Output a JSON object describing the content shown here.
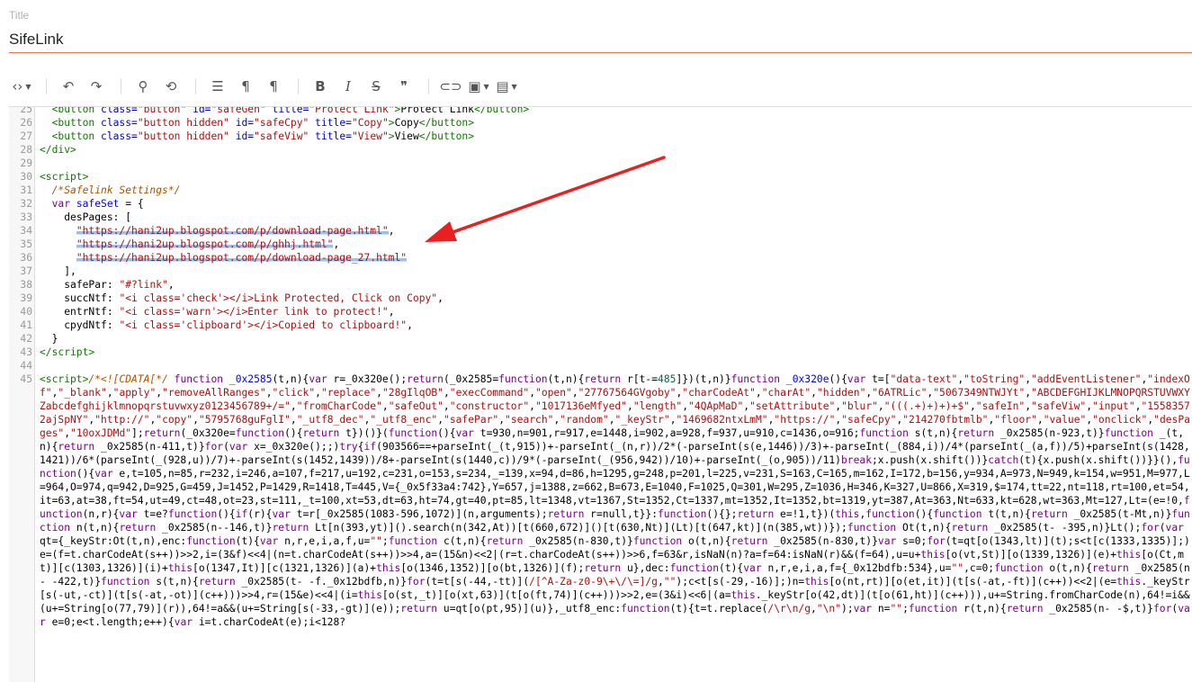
{
  "title_field": {
    "label": "Title",
    "value": "SifeLink"
  },
  "toolbar": {
    "items": [
      {
        "icon": "code-view-icon",
        "glyph": "‹›",
        "caret": true
      },
      {
        "sep": true
      },
      {
        "icon": "undo-icon",
        "glyph": "↶"
      },
      {
        "icon": "redo-icon",
        "glyph": "↷"
      },
      {
        "sep": true
      },
      {
        "icon": "search-icon",
        "glyph": "⚲"
      },
      {
        "icon": "find-replace-icon",
        "glyph": "⟲"
      },
      {
        "sep": true
      },
      {
        "icon": "align-icon",
        "glyph": "☰"
      },
      {
        "icon": "ltr-icon",
        "glyph": "¶"
      },
      {
        "icon": "rtl-icon",
        "glyph": "¶"
      },
      {
        "sep": true
      },
      {
        "icon": "bold-icon",
        "glyph": "B"
      },
      {
        "icon": "italic-icon",
        "glyph": "I"
      },
      {
        "icon": "strikethrough-icon",
        "glyph": "S"
      },
      {
        "icon": "quote-icon",
        "glyph": "❞"
      },
      {
        "sep": true
      },
      {
        "icon": "link-icon",
        "glyph": "⊂⊃"
      },
      {
        "icon": "image-icon",
        "glyph": "▣",
        "caret": true
      },
      {
        "icon": "video-icon",
        "glyph": "▤",
        "caret": true
      }
    ]
  },
  "code_lines": [
    {
      "n": "25",
      "html": "  <span class='tag'>&lt;button</span> <span class='attr'>class=</span><span class='str'>\"button\"</span> <span class='attr'>id=</span><span class='str'>\"safeGen\"</span> <span class='attr'>title=</span><span class='str'>\"Protect Link\"</span><span class='tag'>&gt;</span>Protect Link<span class='tag'>&lt;/button&gt;</span>"
    },
    {
      "n": "26",
      "html": "  <span class='tag'>&lt;button</span> <span class='attr'>class=</span><span class='str'>\"button hidden\"</span> <span class='attr'>id=</span><span class='str'>\"safeCpy\"</span> <span class='attr'>title=</span><span class='str'>\"Copy\"</span><span class='tag'>&gt;</span>Copy<span class='tag'>&lt;/button&gt;</span>"
    },
    {
      "n": "27",
      "html": "  <span class='tag'>&lt;button</span> <span class='attr'>class=</span><span class='str'>\"button hidden\"</span> <span class='attr'>id=</span><span class='str'>\"safeViw\"</span> <span class='attr'>title=</span><span class='str'>\"View\"</span><span class='tag'>&gt;</span>View<span class='tag'>&lt;/button&gt;</span>"
    },
    {
      "n": "28",
      "html": "<span class='tag'>&lt;/div&gt;</span>"
    },
    {
      "n": "29",
      "html": ""
    },
    {
      "n": "30",
      "html": "<span class='tag'>&lt;script&gt;</span>"
    },
    {
      "n": "31",
      "html": "  <span class='cm'>/*Safelink Settings*/</span>"
    },
    {
      "n": "32",
      "html": "  <span class='kw'>var</span> <span class='def'>safeSet</span> = {"
    },
    {
      "n": "33",
      "html": "    desPages: ["
    },
    {
      "n": "34",
      "html": "      <span class='str hl'>\"https://hani2up.blogspot.com/p/download-page.html\"</span>,"
    },
    {
      "n": "35",
      "html": "      <span class='str hl'>\"https://hani2up.blogspot.com/p/ghhj.html\"</span>,"
    },
    {
      "n": "36",
      "html": "      <span class='str hl'>\"https://hani2up.blogspot.com/p/download-page_27.html\"</span>"
    },
    {
      "n": "37",
      "html": "    ],"
    },
    {
      "n": "38",
      "html": "    safePar: <span class='str'>\"#?link\"</span>,"
    },
    {
      "n": "39",
      "html": "    succNtf: <span class='str'>\"&lt;i class='check'&gt;&lt;/i&gt;Link Protected, Click on Copy\"</span>,"
    },
    {
      "n": "40",
      "html": "    entrNtf: <span class='str'>\"&lt;i class='warn'&gt;&lt;/i&gt;Enter link to protect!\"</span>,"
    },
    {
      "n": "41",
      "html": "    cpydNtf: <span class='str'>\"&lt;i class='clipboard'&gt;&lt;/i&gt;Copied to clipboard!\"</span>,"
    },
    {
      "n": "42",
      "html": "  }"
    },
    {
      "n": "43",
      "html": "<span class='tag'>&lt;/script&gt;</span>"
    },
    {
      "n": "44",
      "html": ""
    },
    {
      "n": "45",
      "html": "<span class='tag'>&lt;script&gt;</span><span class='cm'>/*&lt;![CDATA[*/</span> <span class='kw'>function</span> <span class='def'>_0x2585</span>(t,n){<span class='kw'>var</span> r=_0x320e();<span class='kw'>return</span>(_0x2585=<span class='kw'>function</span>(t,n){<span class='kw'>return</span> r[t-=<span class='num'>485</span>]})(t,n)}<span class='kw'>function</span> <span class='def'>_0x320e</span>(){<span class='kw'>var</span> t=[<span class='str'>\"data-text\"</span>,<span class='str'>\"toString\"</span>,<span class='str'>\"addEventListener\"</span>,<span class='str'>\"indexOf\"</span>,<span class='str'>\"_blank\"</span>,<span class='str'>\"apply\"</span>,<span class='str'>\"removeAllRanges\"</span>,<span class='str'>\"click\"</span>,<span class='str'>\"replace\"</span>,<span class='str'>\"28gIlqOB\"</span>,<span class='str'>\"execCommand\"</span>,<span class='str'>\"open\"</span>,<span class='str'>\"27767564GVgoby\"</span>,<span class='str'>\"charCodeAt\"</span>,<span class='str'>\"charAt\"</span>,<span class='str'>\"hidden\"</span>,<span class='str'>\"6ATRLic\"</span>,<span class='str'>\"5067349NTWJYt\"</span>,<span class='str'>\"ABCDEFGHIJKLMNOPQRSTUVWXYZabcdefghijklmnopqrstuvwxyz0123456789+/=\"</span>,<span class='str'>\"fromCharCode\"</span>,<span class='str'>\"safeOut\"</span>,<span class='str'>\"constructor\"</span>,<span class='str'>\"1017136eMfyed\"</span>,<span class='str'>\"length\"</span>,<span class='str'>\"4QApMaD\"</span>,<span class='str'>\"setAttribute\"</span>,<span class='str'>\"blur\"</span>,<span class='str'>\"(((.+)+)+)+$\"</span>,<span class='str'>\"safeIn\"</span>,<span class='str'>\"safeViw\"</span>,<span class='str'>\"input\"</span>,<span class='str'>\"15583572ajSpNY\"</span>,<span class='str'>\"http://\"</span>,<span class='str'>\"copy\"</span>,<span class='str'>\"5795768guFglI\"</span>,<span class='str'>\"_utf8_dec\"</span>,<span class='str'>\"_utf8_enc\"</span>,<span class='str'>\"safePar\"</span>,<span class='str'>\"search\"</span>,<span class='str'>\"random\"</span>,<span class='str'>\"_keyStr\"</span>,<span class='str'>\"1469682ntxLmM\"</span>,<span class='str'>\"https://\"</span>,<span class='str'>\"safeCpy\"</span>,<span class='str'>\"214270fbtmlb\"</span>,<span class='str'>\"floor\"</span>,<span class='str'>\"value\"</span>,<span class='str'>\"onclick\"</span>,<span class='str'>\"desPages\"</span>,<span class='str'>\"10oxJDMd\"</span>];<span class='kw'>return</span>(_0x320e=<span class='kw'>function</span>(){<span class='kw'>return</span> t})()}(<span class='kw'>function</span>(){<span class='kw'>var</span> t=930,n=901,r=917,e=1448,i=902,a=928,f=937,u=910,c=1436,o=916;<span class='kw'>function</span> s(t,n){<span class='kw'>return</span> _0x2585(n-923,t)}<span class='kw'>function</span> _(t,n){<span class='kw'>return</span> _0x2585(n-411,t)}<span class='kw'>for</span>(<span class='kw'>var</span> x=_0x320e();;)<span class='kw'>try</span>{<span class='kw'>if</span>(903566==+parseInt(_(t,915))+-parseInt(_(n,r))/2*(-parseInt(s(e,1446))/3)+-parseInt(_(884,i))/4*(parseInt(_(a,f))/5)+parseInt(s(1428,1421))/6*(parseInt(_(928,u))/7)+-parseInt(s(1452,1439))/8+-parseInt(s(1440,c))/9*(-parseInt(_(956,942))/10)+-parseInt(_(o,905))/11)<span class='kw'>break</span>;x.push(x.shift())}<span class='kw'>catch</span>(t){x.push(x.shift())}}(),<span class='kw'>function</span>(){<span class='kw'>var</span> e,t=105,n=85,r=232,i=246,a=107,f=217,u=192,c=231,o=153,s=234,_=139,x=94,d=86,h=1295,g=248,p=201,l=225,v=231,S=163,C=165,m=162,I=172,b=156,y=934,A=973,N=949,k=154,w=951,M=977,L=964,O=974,q=942,D=925,G=459,J=1452,P=1429,R=1418,T=445,V={_0x5f33a4:742},Y=657,j=1388,z=662,B=673,E=1040,F=1025,Q=301,W=295,Z=1036,H=346,K=327,U=866,X=319,$=174,tt=22,nt=118,rt=100,et=54,it=63,at=38,ft=54,ut=49,ct=48,ot=23,st=111,_t=100,xt=53,dt=63,ht=74,gt=40,pt=85,lt=1348,vt=1367,St=1352,Ct=1337,mt=1352,It=1352,bt=1319,yt=387,At=363,Nt=633,kt=628,wt=363,Mt=127,Lt=(e=!0,<span class='kw'>function</span>(n,r){<span class='kw'>var</span> t=e?<span class='kw'>function</span>(){<span class='kw'>if</span>(r){<span class='kw'>var</span> t=r[_0x2585(1083-596,1072)](n,arguments);<span class='kw'>return</span> r=null,t}}:<span class='kw'>function</span>(){};<span class='kw'>return</span> e=!1,t})(<span class='kw'>this</span>,<span class='kw'>function</span>(){<span class='kw'>function</span> t(t,n){<span class='kw'>return</span> _0x2585(t-Mt,n)}<span class='kw'>function</span> n(t,n){<span class='kw'>return</span> _0x2585(n--146,t)}<span class='kw'>return</span> Lt[n(393,yt)]().search(n(342,At))[t(660,672)]()[t(630,Nt)](Lt)[t(647,kt)](n(385,wt))});<span class='kw'>function</span> Ot(t,n){<span class='kw'>return</span> _0x2585(t- -395,n)}Lt();<span class='kw'>for</span>(<span class='kw'>var</span> qt={_keyStr:Ot(t,n),enc:<span class='kw'>function</span>(t){<span class='kw'>var</span> n,r,e,i,a,f,u=<span class='str'>\"\"</span>;<span class='kw'>function</span> c(t,n){<span class='kw'>return</span> _0x2585(n-830,t)}<span class='kw'>function</span> o(t,n){<span class='kw'>return</span> _0x2585(n-830,t)}<span class='kw'>var</span> s=0;<span class='kw'>for</span>(t=qt[o(1343,lt)](t);s&lt;t[c(1333,1335)];)e=(f=t.charCodeAt(s++))&gt;&gt;2,i=(3&amp;f)&lt;&lt;4|(n=t.charCodeAt(s++))&gt;&gt;4,a=(15&amp;n)&lt;&lt;2|(r=t.charCodeAt(s++))&gt;&gt;6,f=63&amp;r,isNaN(n)?a=f=64:isNaN(r)&amp;&amp;(f=64),u=u+<span class='kw'>this</span>[o(vt,St)][o(1339,1326)](e)+<span class='kw'>this</span>[o(Ct,mt)][c(1303,1326)](i)+<span class='kw'>this</span>[o(1347,It)][c(1321,1326)](a)+<span class='kw'>this</span>[o(1346,1352)][o(bt,1326)](f);<span class='kw'>return</span> u},dec:<span class='kw'>function</span>(t){<span class='kw'>var</span> n,r,e,i,a,f={_0x12bdfb:534},u=<span class='str'>\"\"</span>,c=0;<span class='kw'>function</span> o(t,n){<span class='kw'>return</span> _0x2585(n- -422,t)}<span class='kw'>function</span> s(t,n){<span class='kw'>return</span> _0x2585(t- -f._0x12bdfb,n)}<span class='kw'>for</span>(t=t[s(-44,-tt)](<span class='str'>/[^A-Za-z0-9\\+\\/\\=]/g</span>,<span class='str'>\"\"</span>);c&lt;t[s(-29,-16)];)n=<span class='kw'>this</span>[o(nt,rt)][o(et,it)](t[s(-at,-ft)](c++))&lt;&lt;2|(e=<span class='kw'>this</span>._keyStr[s(-ut,-ct)](t[s(-at,-ot)](c++)))&gt;&gt;4,r=(15&amp;e)&lt;&lt;4|(i=<span class='kw'>this</span>[o(st,_t)][o(xt,63)](t[o(ft,74)](c++)))&gt;&gt;2,e=(3&amp;i)&lt;&lt;6|(a=<span class='kw'>this</span>._keyStr[o(42,dt)](t[o(61,ht)](c++))),u+=String.fromCharCode(n),64!=i&amp;&amp;(u+=String[o(77,79)](r)),64!=a&amp;&amp;(u+=String[s(-33,-gt)](e));<span class='kw'>return</span> u=qt[o(pt,95)](u)},_utf8_enc:<span class='kw'>function</span>(t){t=t.replace(<span class='str'>/\\r\\n/g</span>,<span class='str'>\"\\n\"</span>);<span class='kw'>var</span> n=<span class='str'>\"\"</span>;<span class='kw'>function</span> r(t,n){<span class='kw'>return</span> _0x2585(n- -$,t)}<span class='kw'>for</span>(<span class='kw'>var</span> e=0;e&lt;t.length;e++){<span class='kw'>var</span> i=t.charCodeAt(e);i&lt;128?"
    }
  ],
  "colors": {
    "accent": "#e8744a",
    "arrow": "#e82020",
    "highlight": "#468ce6"
  }
}
